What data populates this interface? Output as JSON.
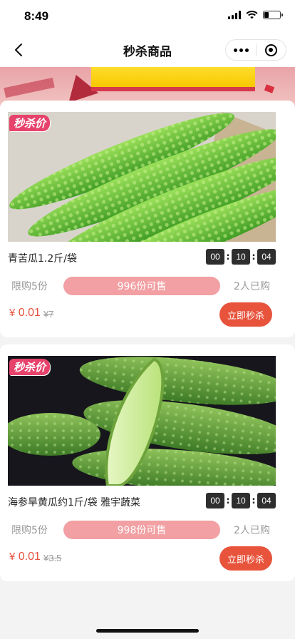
{
  "status_bar": {
    "time": "8:49"
  },
  "nav": {
    "title": "秒杀商品"
  },
  "products": [
    {
      "tag": "秒杀价",
      "name": "青苦瓜1.2斤/袋",
      "countdown": {
        "hours": "00",
        "minutes": "10",
        "seconds": "04"
      },
      "limit": "限购5份",
      "available": "996份可售",
      "progress_percent": 0,
      "bought": "2人已购",
      "currency": "¥",
      "price": "0.01",
      "original_price": "¥7",
      "button_label": "立即秒杀",
      "image": "bitter-melon"
    },
    {
      "tag": "秒杀价",
      "name": "海参旱黄瓜约1斤/袋 雅宇蔬菜",
      "countdown": {
        "hours": "00",
        "minutes": "10",
        "seconds": "04"
      },
      "limit": "限购5份",
      "available": "998份可售",
      "progress_percent": 0,
      "bought": "2人已购",
      "currency": "¥",
      "price": "0.01",
      "original_price": "¥3.5",
      "button_label": "立即秒杀",
      "image": "cucumber"
    }
  ],
  "colors": {
    "accent": "#e8533c",
    "progress": "#f2a0a3",
    "tag": "#e6426b"
  },
  "icons": [
    "back-arrow-icon",
    "more-dots-icon",
    "target-close-icon",
    "signal-icon",
    "wifi-icon",
    "battery-icon"
  ]
}
